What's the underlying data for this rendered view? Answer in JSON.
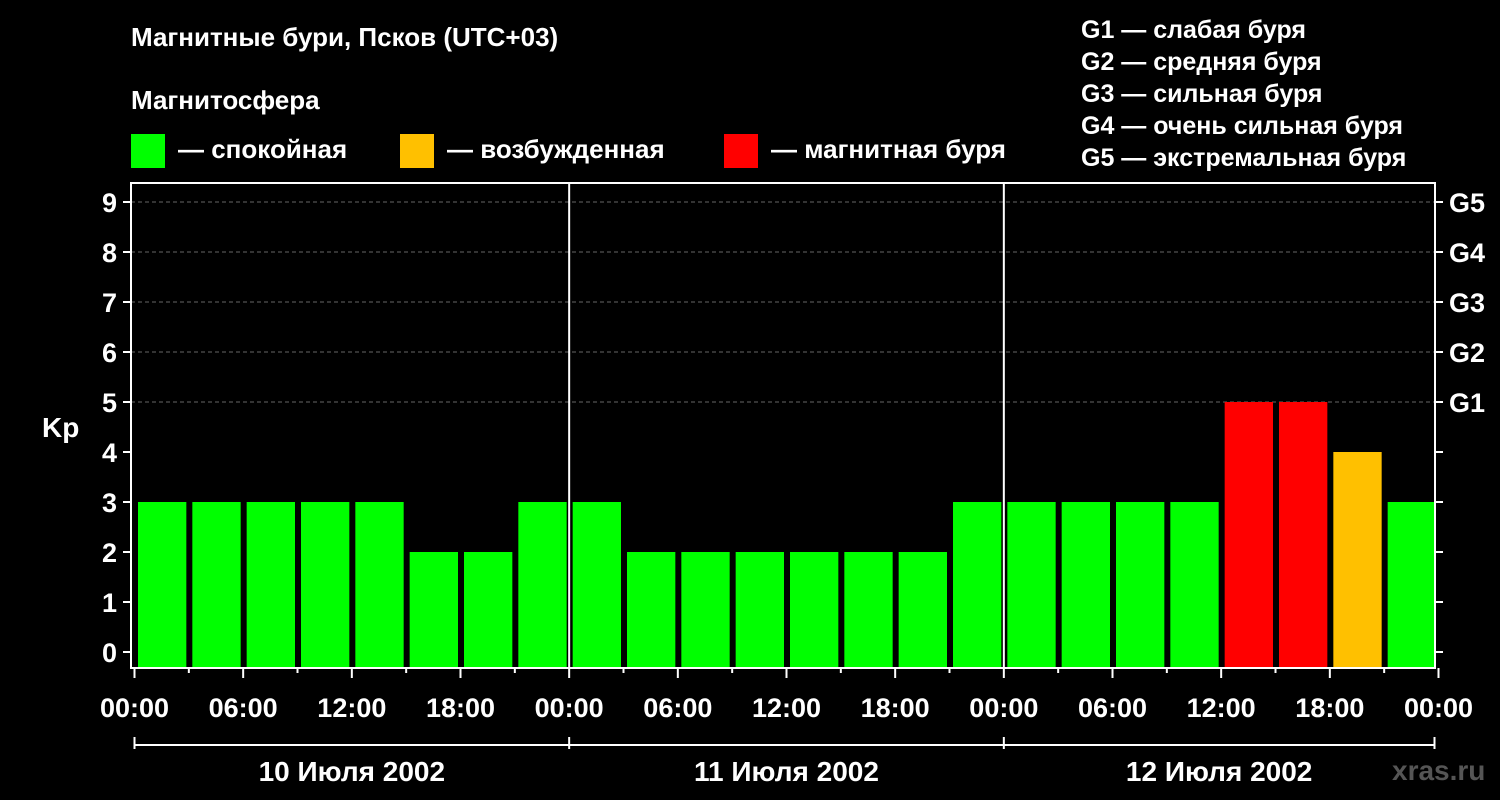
{
  "title": "Магнитные бури, Псков (UTC+03)",
  "subtitle": "Магнитосфера",
  "legend": {
    "calm": {
      "label": "— спокойная",
      "color": "#00ff00"
    },
    "excited": {
      "label": "— возбужденная",
      "color": "#ffc000"
    },
    "storm": {
      "label": "— магнитная буря",
      "color": "#ff0000"
    }
  },
  "g_legend": [
    "G1 — слабая буря",
    "G2 — средняя буря",
    "G3 — сильная буря",
    "G4 — очень сильная буря",
    "G5 — экстремальная буря"
  ],
  "watermark": "xras.ru",
  "chart_data": {
    "type": "bar",
    "ylabel": "Kp",
    "ylim": [
      0,
      9
    ],
    "yticks": [
      0,
      1,
      2,
      3,
      4,
      5,
      6,
      7,
      8,
      9
    ],
    "right_axis_labels": [
      {
        "value": 5,
        "label": "G1"
      },
      {
        "value": 6,
        "label": "G2"
      },
      {
        "value": 7,
        "label": "G3"
      },
      {
        "value": 8,
        "label": "G4"
      },
      {
        "value": 9,
        "label": "G5"
      }
    ],
    "xticks": [
      "00:00",
      "06:00",
      "12:00",
      "18:00",
      "00:00",
      "06:00",
      "12:00",
      "18:00",
      "00:00",
      "06:00",
      "12:00",
      "18:00",
      "00:00"
    ],
    "days": [
      "10 Июля 2002",
      "11 Июля 2002",
      "12 Июля 2002"
    ],
    "values": [
      3,
      3,
      3,
      3,
      3,
      2,
      2,
      3,
      3,
      2,
      2,
      2,
      2,
      2,
      2,
      3,
      3,
      3,
      3,
      3,
      5,
      5,
      4,
      3
    ],
    "colors": {
      "calm": "#00ff00",
      "excited": "#ffc000",
      "storm": "#ff0000"
    },
    "grid": true
  }
}
